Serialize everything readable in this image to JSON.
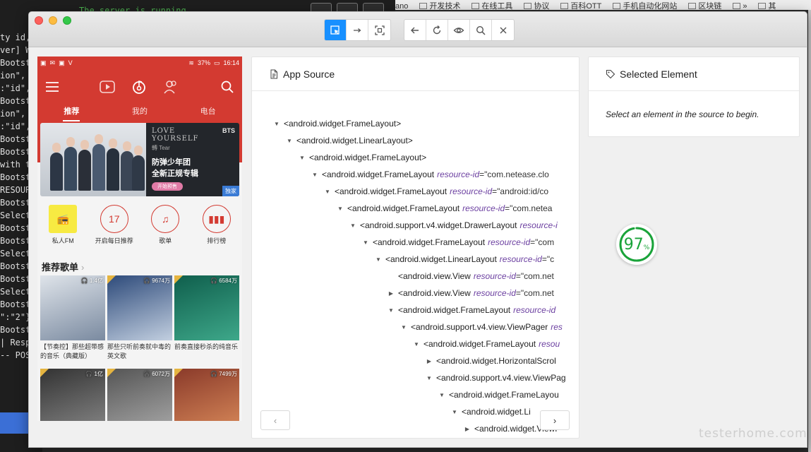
{
  "background": {
    "terminal_status": "The server is running",
    "terminal_lines": [
      "ty id,",
      "ver] W",
      "Bootst",
      "ion\",",
      ":\"id\",",
      "Bootst",
      "ion\",",
      ":\"id\",",
      "Bootst",
      "Bootst",
      "with t",
      "Bootst",
      "RESOUR",
      "Bootst",
      "Select",
      "Bootst",
      "Bootst",
      "Select",
      "Bootst",
      "Bootst",
      "Select",
      "Bootst",
      "\":\"2\"}",
      "Bootst",
      "| Resp",
      "-- POS"
    ],
    "bookmarks": [
      "ano",
      "开发技术",
      "在线工具",
      "协议",
      "百科OTT",
      "手机自动化网站",
      "区块链",
      "» ",
      "其"
    ]
  },
  "window": {
    "toolbar_left": [
      {
        "name": "select-elements-button",
        "icon": "cursor-select-icon",
        "active": true
      },
      {
        "name": "swipe-button",
        "icon": "swipe-arrow-icon",
        "active": false
      },
      {
        "name": "tap-by-coordinates-button",
        "icon": "crop-frame-icon",
        "active": false
      }
    ],
    "toolbar_right": [
      {
        "name": "back-button",
        "icon": "arrow-left-icon"
      },
      {
        "name": "refresh-button",
        "icon": "refresh-icon"
      },
      {
        "name": "record-button",
        "icon": "eye-icon"
      },
      {
        "name": "search-button",
        "icon": "search-icon"
      },
      {
        "name": "quit-button",
        "icon": "close-icon"
      }
    ]
  },
  "device": {
    "status_bar": {
      "battery": "37%",
      "time": "16:14"
    },
    "tabs": [
      "推荐",
      "我的",
      "电台"
    ],
    "banner": {
      "line1": "LOVE",
      "line2": "YOURSELF",
      "line3": "轉 Tear",
      "line4": "防弹少年团",
      "line5": "全新正规专辑",
      "presale": "开始预售",
      "tag": "独家",
      "corner": "BTS"
    },
    "shortcuts": [
      {
        "label": "私人FM",
        "glyph": "📻"
      },
      {
        "label": "开启每日推荐",
        "glyph": "17"
      },
      {
        "label": "歌单",
        "glyph": "♫"
      },
      {
        "label": "排行榜",
        "glyph": "▮▮▮"
      }
    ],
    "recommend_title": "推荐歌单",
    "playlists": [
      {
        "count": "1.4亿",
        "caption": "【节奏控】那些超带感的音乐（典藏版）",
        "colors": [
          "#dfe4ea",
          "#7a8aa0"
        ]
      },
      {
        "count": "9674万",
        "caption": "那些只听前奏就中毒的英文歌",
        "colors": [
          "#2d4a7a",
          "#c2cfe0"
        ]
      },
      {
        "count": "6584万",
        "caption": "前奏直接秒杀的纯音乐",
        "colors": [
          "#0f5e4c",
          "#3ea88a"
        ]
      },
      {
        "count": "1亿",
        "caption": "",
        "colors": [
          "#333",
          "#888"
        ]
      },
      {
        "count": "6072万",
        "caption": "",
        "colors": [
          "#555",
          "#aaa"
        ]
      },
      {
        "count": "7499万",
        "caption": "",
        "colors": [
          "#8a3a2a",
          "#d98a5a"
        ]
      }
    ]
  },
  "source": {
    "title": "App Source",
    "nodes": [
      {
        "depth": 0,
        "caret": "down",
        "tag": "<android.widget.FrameLayout>",
        "attr": "",
        "val": ""
      },
      {
        "depth": 1,
        "caret": "down",
        "tag": "<android.widget.LinearLayout>",
        "attr": "",
        "val": ""
      },
      {
        "depth": 2,
        "caret": "down",
        "tag": "<android.widget.FrameLayout>",
        "attr": "",
        "val": ""
      },
      {
        "depth": 3,
        "caret": "down",
        "tag": "<android.widget.FrameLayout",
        "attr": "resource-id",
        "val": "=\"com.netease.clo"
      },
      {
        "depth": 4,
        "caret": "down",
        "tag": "<android.widget.FrameLayout",
        "attr": "resource-id",
        "val": "=\"android:id/co"
      },
      {
        "depth": 5,
        "caret": "down",
        "tag": "<android.widget.FrameLayout",
        "attr": "resource-id",
        "val": "=\"com.netea"
      },
      {
        "depth": 6,
        "caret": "down",
        "tag": "<android.support.v4.widget.DrawerLayout",
        "attr": "resource-i",
        "val": ""
      },
      {
        "depth": 7,
        "caret": "down",
        "tag": "<android.widget.FrameLayout",
        "attr": "resource-id",
        "val": "=\"com"
      },
      {
        "depth": 8,
        "caret": "down",
        "tag": "<android.widget.LinearLayout",
        "attr": "resource-id",
        "val": "=\"c"
      },
      {
        "depth": 9,
        "caret": "",
        "tag": "<android.view.View",
        "attr": "resource-id",
        "val": "=\"com.net"
      },
      {
        "depth": 9,
        "caret": "right",
        "tag": "<android.view.View",
        "attr": "resource-id",
        "val": "=\"com.net"
      },
      {
        "depth": 9,
        "caret": "down",
        "tag": "<android.widget.FrameLayout",
        "attr": "resource-id",
        "val": ""
      },
      {
        "depth": 10,
        "caret": "down",
        "tag": "<android.support.v4.view.ViewPager",
        "attr": "res",
        "val": ""
      },
      {
        "depth": 11,
        "caret": "down",
        "tag": "<android.widget.FrameLayout",
        "attr": "resou",
        "val": ""
      },
      {
        "depth": 12,
        "caret": "right",
        "tag": "<android.widget.HorizontalScrol",
        "attr": "",
        "val": ""
      },
      {
        "depth": 12,
        "caret": "down",
        "tag": "<android.support.v4.view.ViewPag",
        "attr": "",
        "val": ""
      },
      {
        "depth": 13,
        "caret": "down",
        "tag": "<android.widget.FrameLayou",
        "attr": "",
        "val": ""
      },
      {
        "depth": 14,
        "caret": "down",
        "tag": "<android.widget.Li",
        "attr": "",
        "val": ""
      },
      {
        "depth": 15,
        "caret": "right",
        "tag": "<android.widget.ViewF",
        "attr": "",
        "val": ""
      }
    ],
    "prev_label": "‹",
    "next_label": "›"
  },
  "selected": {
    "title": "Selected Element",
    "message": "Select an element in the source to begin."
  },
  "badge": {
    "percent": "97",
    "unit": "%",
    "fraction": 0.97,
    "color": "#1aa33a"
  },
  "watermark": "testerhome.com"
}
